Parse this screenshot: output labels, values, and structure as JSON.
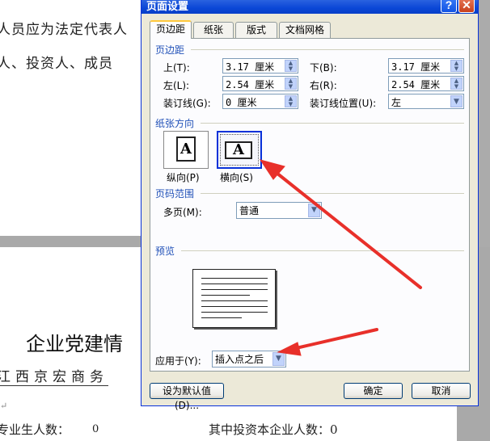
{
  "document": {
    "line1": "人员应为法定代表人",
    "line2": "人、投资人、成员",
    "heading": "企业党建情",
    "underline_text": "江西京宏商务",
    "paragraph_mark": "↵",
    "row_label_a": "专业生人数：",
    "row_value_a": "0",
    "row_label_b": "其中投资本企业人数：",
    "row_value_b": "0"
  },
  "dialog": {
    "title": "页面设置",
    "help_label": "?",
    "close_label": "✕",
    "tabs": [
      {
        "label": "页边距",
        "active": true
      },
      {
        "label": "纸张",
        "active": false
      },
      {
        "label": "版式",
        "active": false
      },
      {
        "label": "文档网格",
        "active": false
      }
    ],
    "margins": {
      "section_title": "页边距",
      "top_label": "上(T):",
      "top_value": "3.17 厘米",
      "bottom_label": "下(B):",
      "bottom_value": "3.17 厘米",
      "left_label": "左(L):",
      "left_value": "2.54 厘米",
      "right_label": "右(R):",
      "right_value": "2.54 厘米",
      "gutter_label": "装订线(G):",
      "gutter_value": "0 厘米",
      "gutter_pos_label": "装订线位置(U):",
      "gutter_pos_value": "左"
    },
    "orientation": {
      "section_title": "纸张方向",
      "glyph": "A",
      "portrait_label": "纵向(P)",
      "landscape_label": "横向(S)",
      "selected": "landscape"
    },
    "pages": {
      "section_title": "页码范围",
      "multiple_label": "多页(M):",
      "multiple_value": "普通"
    },
    "preview": {
      "section_title": "预览",
      "apply_label": "应用于(Y):",
      "apply_value": "插入点之后"
    },
    "buttons": {
      "default_label": "设为默认值(D)...",
      "ok_label": "确定",
      "cancel_label": "取消"
    }
  },
  "annotation_color": "#e8302a"
}
